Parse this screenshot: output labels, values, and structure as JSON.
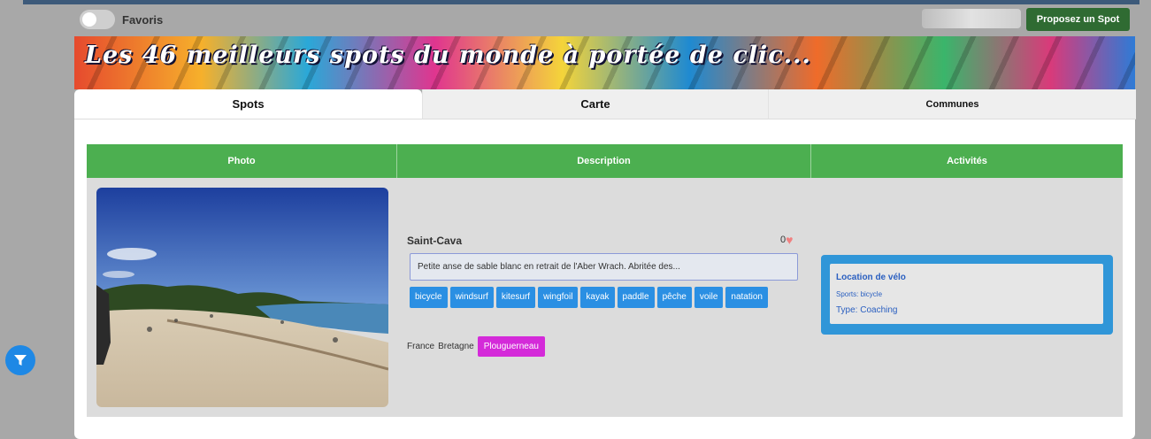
{
  "header": {
    "favorites_label": "Favoris",
    "propose_label": "Proposez un Spot"
  },
  "banner": {
    "title": "Les 46 meilleurs spots du monde à portée de clic..."
  },
  "tabs": [
    {
      "label": "Spots",
      "active": true
    },
    {
      "label": "Carte",
      "active": false
    },
    {
      "label": "Communes",
      "active": false
    }
  ],
  "table": {
    "headers": [
      "Photo",
      "Description",
      "Activités"
    ]
  },
  "spot": {
    "name": "Saint-Cava",
    "likes": "0",
    "description": "Petite anse de sable blanc en retrait de l'Aber Wrach. Abritée des...",
    "tags": [
      "bicycle",
      "windsurf",
      "kitesurf",
      "wingfoil",
      "kayak",
      "paddle",
      "pêche",
      "voile",
      "natation"
    ],
    "country": "France",
    "region": "Bretagne",
    "commune": "Plouguerneau"
  },
  "activity": {
    "title": "Location de vélo",
    "sports": "Sports: bicycle",
    "type": "Type: Coaching"
  },
  "colors": {
    "header_green": "#4caf50",
    "tag_blue": "#2a8fe3",
    "commune_magenta": "#d42ad9",
    "activity_blue": "#3096d8",
    "propose_green": "#2f6b32"
  },
  "icons": {
    "heart": "heart-icon",
    "filter": "filter-icon"
  }
}
